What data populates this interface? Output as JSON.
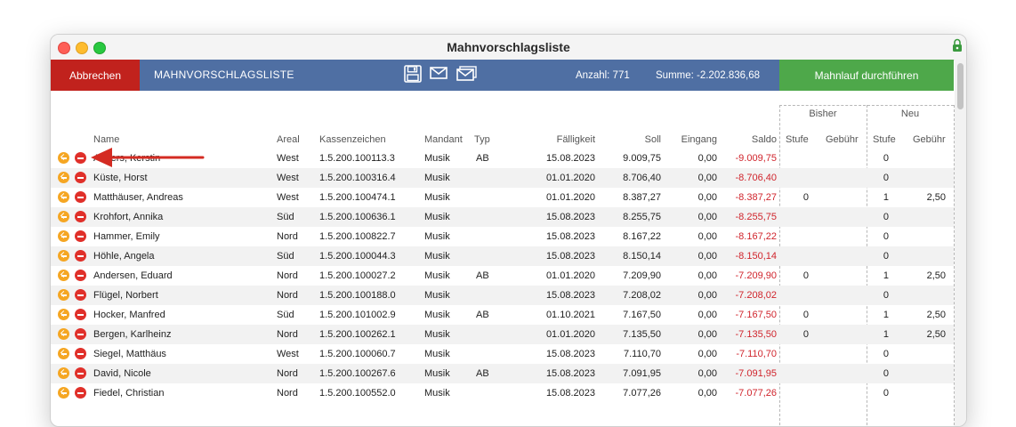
{
  "window": {
    "title": "Mahnvorschlagsliste"
  },
  "toolbar": {
    "cancel_label": "Abbrechen",
    "title": "MAHNVORSCHLAGSLISTE",
    "icons": [
      "save-icon",
      "mail-icon",
      "mail-stack-icon"
    ],
    "count_label": "Anzahl: 771",
    "sum_label": "Summe: -2.202.836,68",
    "run_label": "Mahnlauf durchführen",
    "colors": {
      "cancel": "#c1221d",
      "bar": "#4f6fa3",
      "run": "#4ea84a",
      "negative": "#d0242c"
    }
  },
  "table": {
    "groups": {
      "bisher": "Bisher",
      "neu": "Neu"
    },
    "headers": {
      "name": "Name",
      "areal": "Areal",
      "kassenzeichen": "Kassenzeichen",
      "mandant": "Mandant",
      "typ": "Typ",
      "faelligkeit": "Fälligkeit",
      "soll": "Soll",
      "eingang": "Eingang",
      "saldo": "Saldo",
      "stufe_bisher": "Stufe",
      "gebuehr_bisher": "Gebühr",
      "stufe_neu": "Stufe",
      "gebuehr_neu": "Gebühr"
    },
    "rows": [
      {
        "name": "Anders, Kerstin",
        "areal": "West",
        "kassenzeichen": "1.5.200.100113.3",
        "mandant": "Musik",
        "typ": "AB",
        "faelligkeit": "15.08.2023",
        "soll": "9.009,75",
        "eingang": "0,00",
        "saldo": "-9.009,75",
        "stufe_bisher": "",
        "gebuehr_bisher": "",
        "stufe_neu": "0",
        "gebuehr_neu": ""
      },
      {
        "name": "Küste, Horst",
        "areal": "West",
        "kassenzeichen": "1.5.200.100316.4",
        "mandant": "Musik",
        "typ": "",
        "faelligkeit": "01.01.2020",
        "soll": "8.706,40",
        "eingang": "0,00",
        "saldo": "-8.706,40",
        "stufe_bisher": "",
        "gebuehr_bisher": "",
        "stufe_neu": "0",
        "gebuehr_neu": ""
      },
      {
        "name": "Matthäuser, Andreas",
        "areal": "West",
        "kassenzeichen": "1.5.200.100474.1",
        "mandant": "Musik",
        "typ": "",
        "faelligkeit": "01.01.2020",
        "soll": "8.387,27",
        "eingang": "0,00",
        "saldo": "-8.387,27",
        "stufe_bisher": "0",
        "gebuehr_bisher": "",
        "stufe_neu": "1",
        "gebuehr_neu": "2,50"
      },
      {
        "name": "Krohfort, Annika",
        "areal": "Süd",
        "kassenzeichen": "1.5.200.100636.1",
        "mandant": "Musik",
        "typ": "",
        "faelligkeit": "15.08.2023",
        "soll": "8.255,75",
        "eingang": "0,00",
        "saldo": "-8.255,75",
        "stufe_bisher": "",
        "gebuehr_bisher": "",
        "stufe_neu": "0",
        "gebuehr_neu": ""
      },
      {
        "name": "Hammer, Emily",
        "areal": "Nord",
        "kassenzeichen": "1.5.200.100822.7",
        "mandant": "Musik",
        "typ": "",
        "faelligkeit": "15.08.2023",
        "soll": "8.167,22",
        "eingang": "0,00",
        "saldo": "-8.167,22",
        "stufe_bisher": "",
        "gebuehr_bisher": "",
        "stufe_neu": "0",
        "gebuehr_neu": ""
      },
      {
        "name": "Höhle, Angela",
        "areal": "Süd",
        "kassenzeichen": "1.5.200.100044.3",
        "mandant": "Musik",
        "typ": "",
        "faelligkeit": "15.08.2023",
        "soll": "8.150,14",
        "eingang": "0,00",
        "saldo": "-8.150,14",
        "stufe_bisher": "",
        "gebuehr_bisher": "",
        "stufe_neu": "0",
        "gebuehr_neu": ""
      },
      {
        "name": "Andersen, Eduard",
        "areal": "Nord",
        "kassenzeichen": "1.5.200.100027.2",
        "mandant": "Musik",
        "typ": "AB",
        "faelligkeit": "01.01.2020",
        "soll": "7.209,90",
        "eingang": "0,00",
        "saldo": "-7.209,90",
        "stufe_bisher": "0",
        "gebuehr_bisher": "",
        "stufe_neu": "1",
        "gebuehr_neu": "2,50"
      },
      {
        "name": "Flügel, Norbert",
        "areal": "Nord",
        "kassenzeichen": "1.5.200.100188.0",
        "mandant": "Musik",
        "typ": "",
        "faelligkeit": "15.08.2023",
        "soll": "7.208,02",
        "eingang": "0,00",
        "saldo": "-7.208,02",
        "stufe_bisher": "",
        "gebuehr_bisher": "",
        "stufe_neu": "0",
        "gebuehr_neu": ""
      },
      {
        "name": "Hocker, Manfred",
        "areal": "Süd",
        "kassenzeichen": "1.5.200.101002.9",
        "mandant": "Musik",
        "typ": "AB",
        "faelligkeit": "01.10.2021",
        "soll": "7.167,50",
        "eingang": "0,00",
        "saldo": "-7.167,50",
        "stufe_bisher": "0",
        "gebuehr_bisher": "",
        "stufe_neu": "1",
        "gebuehr_neu": "2,50"
      },
      {
        "name": "Bergen, Karlheinz",
        "areal": "Nord",
        "kassenzeichen": "1.5.200.100262.1",
        "mandant": "Musik",
        "typ": "",
        "faelligkeit": "01.01.2020",
        "soll": "7.135,50",
        "eingang": "0,00",
        "saldo": "-7.135,50",
        "stufe_bisher": "0",
        "gebuehr_bisher": "",
        "stufe_neu": "1",
        "gebuehr_neu": "2,50"
      },
      {
        "name": "Siegel, Matthäus",
        "areal": "West",
        "kassenzeichen": "1.5.200.100060.7",
        "mandant": "Musik",
        "typ": "",
        "faelligkeit": "15.08.2023",
        "soll": "7.110,70",
        "eingang": "0,00",
        "saldo": "-7.110,70",
        "stufe_bisher": "",
        "gebuehr_bisher": "",
        "stufe_neu": "0",
        "gebuehr_neu": ""
      },
      {
        "name": "David, Nicole",
        "areal": "Nord",
        "kassenzeichen": "1.5.200.100267.6",
        "mandant": "Musik",
        "typ": "AB",
        "faelligkeit": "15.08.2023",
        "soll": "7.091,95",
        "eingang": "0,00",
        "saldo": "-7.091,95",
        "stufe_bisher": "",
        "gebuehr_bisher": "",
        "stufe_neu": "0",
        "gebuehr_neu": ""
      },
      {
        "name": "Fiedel, Christian",
        "areal": "Nord",
        "kassenzeichen": "1.5.200.100552.0",
        "mandant": "Musik",
        "typ": "",
        "faelligkeit": "15.08.2023",
        "soll": "7.077,26",
        "eingang": "0,00",
        "saldo": "-7.077,26",
        "stufe_bisher": "",
        "gebuehr_bisher": "",
        "stufe_neu": "0",
        "gebuehr_neu": ""
      }
    ]
  }
}
